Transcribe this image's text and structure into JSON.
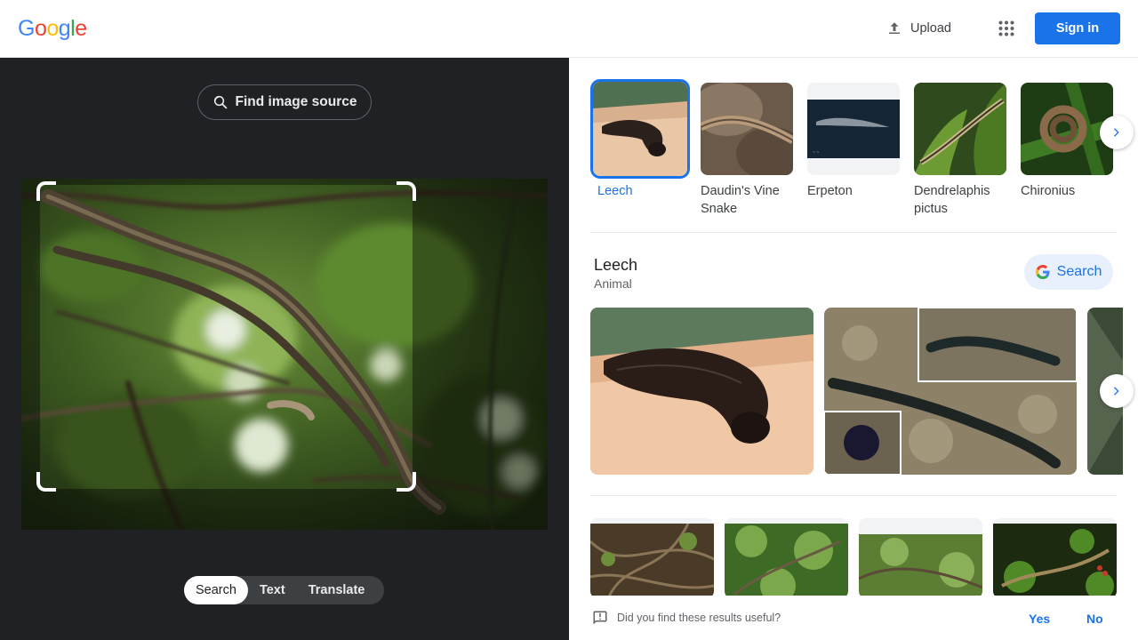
{
  "header": {
    "logo_letters": [
      "G",
      "o",
      "o",
      "g",
      "l",
      "e"
    ],
    "logo_colors": [
      "#4285f4",
      "#ea4335",
      "#fbbc05",
      "#4285f4",
      "#34a853",
      "#ea4335"
    ],
    "upload_label": "Upload",
    "signin_label": "Sign in"
  },
  "left": {
    "find_source_label": "Find image source",
    "modes": [
      "Search",
      "Text",
      "Translate"
    ],
    "active_mode": "Search"
  },
  "right": {
    "strip": [
      {
        "label": "Leech",
        "selected": true
      },
      {
        "label": "Daudin's Vine Snake",
        "selected": false
      },
      {
        "label": "Erpeton",
        "selected": false
      },
      {
        "label": "Dendrelaphis pictus",
        "selected": false
      },
      {
        "label": "Chironius",
        "selected": false
      }
    ],
    "entity": {
      "title": "Leech",
      "subtitle": "Animal",
      "search_label": "Search"
    },
    "feedback": {
      "question": "Did you find these results useful?",
      "yes": "Yes",
      "no": "No"
    }
  },
  "colors": {
    "accent": "#1a73e8",
    "dark_panel": "#202124"
  }
}
